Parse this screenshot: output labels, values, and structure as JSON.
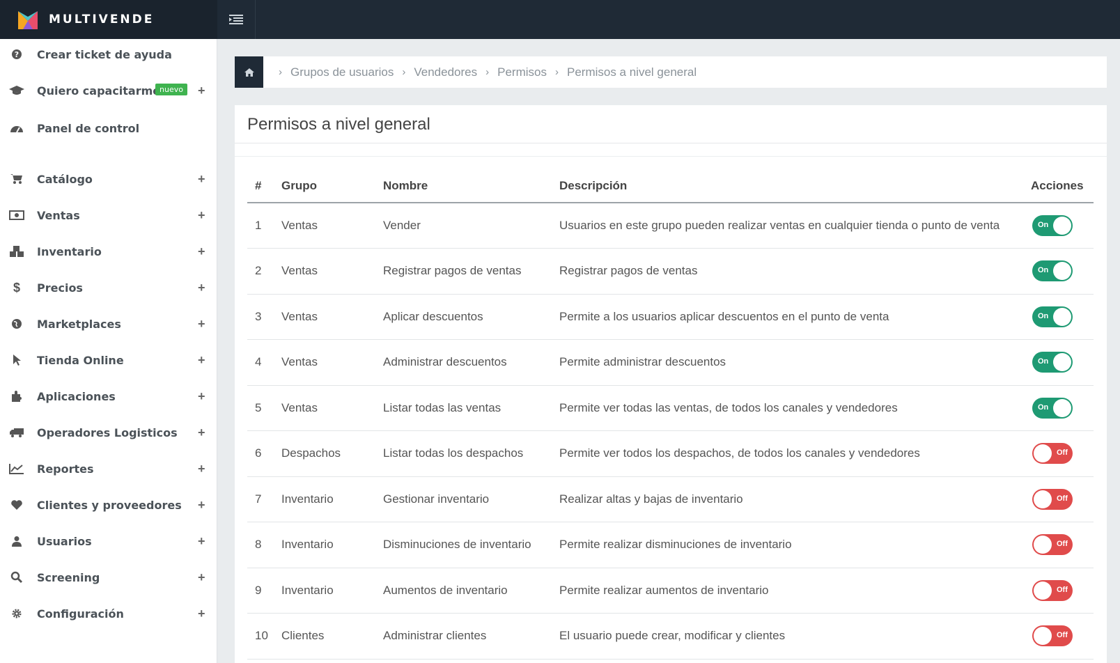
{
  "brand": {
    "name": "MULTIVENDE"
  },
  "sidebar": {
    "items": [
      {
        "label": "Crear ticket de ayuda",
        "icon": "question-circle-icon",
        "plus": ""
      },
      {
        "label": "Quiero capacitarme",
        "icon": "graduation-cap-icon",
        "badge": "nuevo",
        "plus": "+"
      },
      {
        "label": "Panel de control",
        "icon": "dashboard-icon",
        "plus": ""
      },
      {
        "label": "Catálogo",
        "icon": "cart-icon",
        "plus": "+"
      },
      {
        "label": "Ventas",
        "icon": "money-icon",
        "plus": "+"
      },
      {
        "label": "Inventario",
        "icon": "cubes-icon",
        "plus": "+"
      },
      {
        "label": "Precios",
        "icon": "dollar-icon",
        "plus": "+"
      },
      {
        "label": "Marketplaces",
        "icon": "globe-icon",
        "plus": "+"
      },
      {
        "label": "Tienda Online",
        "icon": "pointer-icon",
        "plus": "+"
      },
      {
        "label": "Aplicaciones",
        "icon": "puzzle-icon",
        "plus": "+"
      },
      {
        "label": "Operadores Logisticos",
        "icon": "truck-icon",
        "plus": "+"
      },
      {
        "label": "Reportes",
        "icon": "line-chart-icon",
        "plus": "+"
      },
      {
        "label": "Clientes y proveedores",
        "icon": "heart-icon",
        "plus": "+"
      },
      {
        "label": "Usuarios",
        "icon": "user-icon",
        "plus": "+"
      },
      {
        "label": "Screening",
        "icon": "search-icon",
        "plus": "+"
      },
      {
        "label": "Configuración",
        "icon": "gear-icon",
        "plus": "+"
      }
    ]
  },
  "breadcrumb": {
    "items": [
      "Grupos de usuarios",
      "Vendedores",
      "Permisos",
      "Permisos a nivel general"
    ],
    "separator": "›"
  },
  "panel": {
    "title": "Permisos a nivel general"
  },
  "table": {
    "headers": {
      "num": "#",
      "grupo": "Grupo",
      "nombre": "Nombre",
      "descripcion": "Descripción",
      "acciones": "Acciones"
    },
    "rows": [
      {
        "num": "1",
        "grupo": "Ventas",
        "nombre": "Vender",
        "descripcion": "Usuarios en este grupo pueden realizar ventas en cualquier tienda o punto de venta",
        "toggle": "On"
      },
      {
        "num": "2",
        "grupo": "Ventas",
        "nombre": "Registrar pagos de ventas",
        "descripcion": "Registrar pagos de ventas",
        "toggle": "On"
      },
      {
        "num": "3",
        "grupo": "Ventas",
        "nombre": "Aplicar descuentos",
        "descripcion": "Permite a los usuarios aplicar descuentos en el punto de venta",
        "toggle": "On"
      },
      {
        "num": "4",
        "grupo": "Ventas",
        "nombre": "Administrar descuentos",
        "descripcion": "Permite administrar descuentos",
        "toggle": "On"
      },
      {
        "num": "5",
        "grupo": "Ventas",
        "nombre": "Listar todas las ventas",
        "descripcion": "Permite ver todas las ventas, de todos los canales y vendedores",
        "toggle": "On"
      },
      {
        "num": "6",
        "grupo": "Despachos",
        "nombre": "Listar todas los despachos",
        "descripcion": "Permite ver todos los despachos, de todos los canales y vendedores",
        "toggle": "Off"
      },
      {
        "num": "7",
        "grupo": "Inventario",
        "nombre": "Gestionar inventario",
        "descripcion": "Realizar altas y bajas de inventario",
        "toggle": "Off"
      },
      {
        "num": "8",
        "grupo": "Inventario",
        "nombre": "Disminuciones de inventario",
        "descripcion": "Permite realizar disminuciones de inventario",
        "toggle": "Off"
      },
      {
        "num": "9",
        "grupo": "Inventario",
        "nombre": "Aumentos de inventario",
        "descripcion": "Permite realizar aumentos de inventario",
        "toggle": "Off"
      },
      {
        "num": "10",
        "grupo": "Clientes",
        "nombre": "Administrar clientes",
        "descripcion": "El usuario puede crear, modificar y clientes",
        "toggle": "Off"
      }
    ]
  },
  "colors": {
    "toggle_on": "#1e9a73",
    "toggle_off": "#e04b4b",
    "topbar": "#1f2a36",
    "badge": "#3fb34f"
  }
}
